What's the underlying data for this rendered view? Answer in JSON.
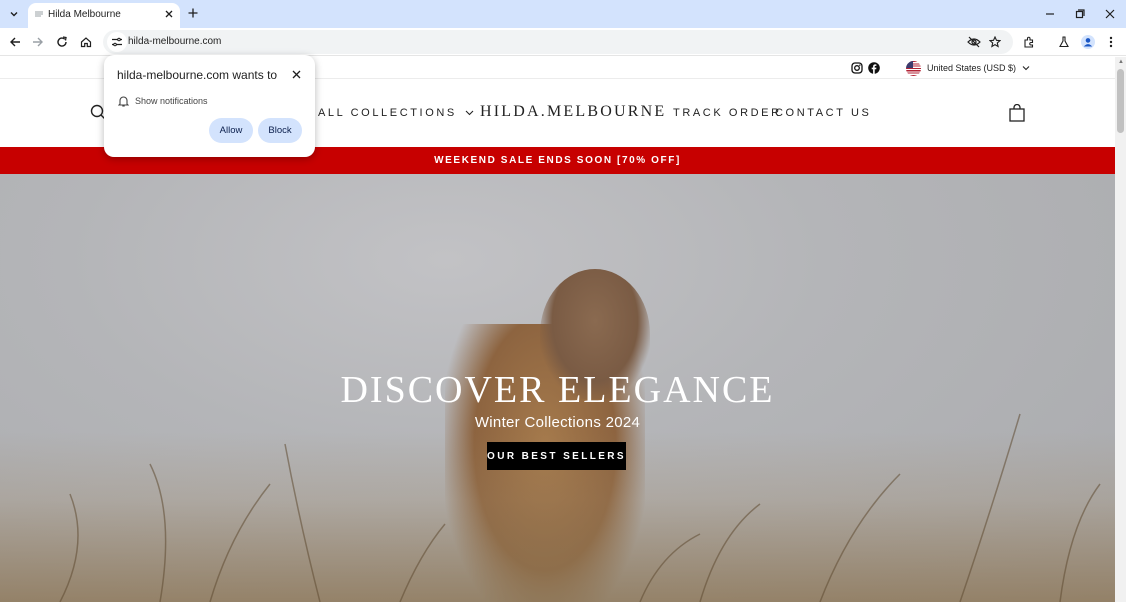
{
  "browser": {
    "tab_title": "Hilda Melbourne",
    "url": "hilda-melbourne.com"
  },
  "permission_popup": {
    "title": "hilda-melbourne.com wants to",
    "permission": "Show notifications",
    "allow_label": "Allow",
    "block_label": "Block"
  },
  "topbar": {
    "currency": "United States (USD $)"
  },
  "header": {
    "nav_left": "ALL COLLECTIONS",
    "logo": "HILDA.MELBOURNE",
    "nav_track": "TRACK ORDER",
    "nav_contact": "CONTACT US"
  },
  "sale_banner": "WEEKEND SALE ENDS SOON [70% OFF]",
  "hero": {
    "title": "DISCOVER ELEGANCE",
    "subtitle": "Winter Collections 2024",
    "button": "OUR BEST SELLERS"
  },
  "colors": {
    "banner_red": "#c70000",
    "tabbar_blue": "#d3e3fd",
    "button_black": "#000000"
  }
}
